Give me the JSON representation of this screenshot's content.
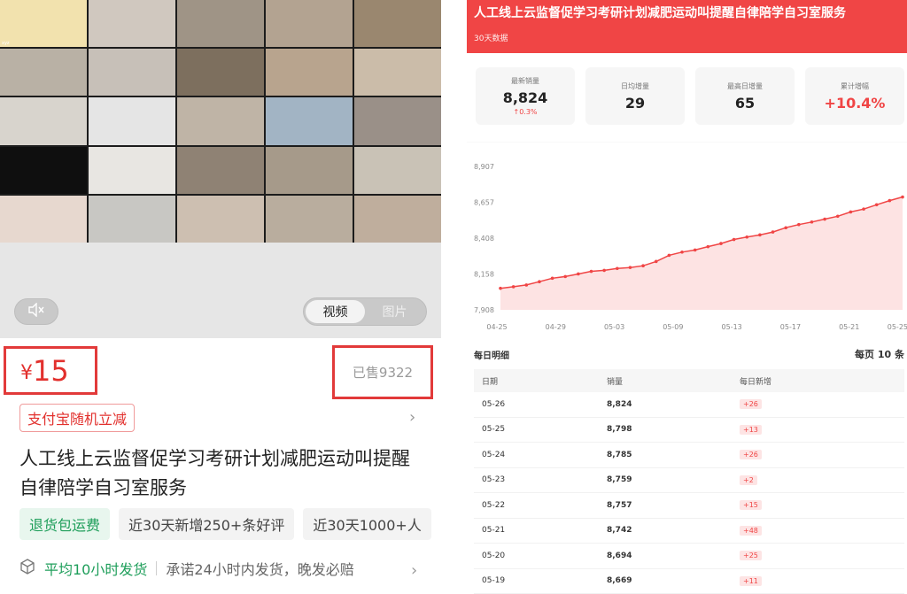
{
  "left": {
    "toggle": {
      "video": "视频",
      "image": "图片"
    },
    "price": {
      "currency": "¥",
      "amount": "15"
    },
    "sold": "已售9322",
    "coupon": "支付宝随机立减",
    "title_line1": "人工线上云监督促学习考研计划减肥运动叫提醒",
    "title_line2": "自律陪学自习室服务",
    "tags": [
      "退货包运费",
      "近30天新增250+条好评",
      "近30天1000+人"
    ],
    "shipping": {
      "highlight": "平均10小时发货",
      "detail": "承诺24小时内发货，晚发必赔"
    },
    "video_tiles": [
      {
        "c": "#f2e2ae",
        "t": "xyz"
      },
      {
        "c": "#d0c8bf",
        "t": ""
      },
      {
        "c": "#9f9486",
        "t": ""
      },
      {
        "c": "#b3a391",
        "t": ""
      },
      {
        "c": "#9a876f",
        "t": ""
      },
      {
        "c": "#b9b1a5",
        "t": ""
      },
      {
        "c": "#c7c0b8",
        "t": ""
      },
      {
        "c": "#7d6f5e",
        "t": ""
      },
      {
        "c": "#b8a48e",
        "t": ""
      },
      {
        "c": "#cbbca9",
        "t": ""
      },
      {
        "c": "#d8d4cd",
        "t": ""
      },
      {
        "c": "#e5e5e5",
        "t": ""
      },
      {
        "c": "#bfb4a6",
        "t": ""
      },
      {
        "c": "#a2b4c4",
        "t": ""
      },
      {
        "c": "#9a9088",
        "t": ""
      },
      {
        "c": "#0f0f0f",
        "t": ""
      },
      {
        "c": "#e8e6e2",
        "t": ""
      },
      {
        "c": "#8f8274",
        "t": ""
      },
      {
        "c": "#a69a8a",
        "t": ""
      },
      {
        "c": "#c9c2b6",
        "t": ""
      },
      {
        "c": "#e7d8cf",
        "t": ""
      },
      {
        "c": "#c8c7c3",
        "t": ""
      },
      {
        "c": "#cdbfb1",
        "t": ""
      },
      {
        "c": "#b9ad9e",
        "t": ""
      },
      {
        "c": "#bfae9d",
        "t": ""
      }
    ]
  },
  "right": {
    "banner": {
      "title": "人工线上云监督促学习考研计划减肥运动叫提醒自律陪学自习室服务",
      "subtitle": "30天数据"
    },
    "kpis": [
      {
        "label": "最新销量",
        "value": "8,824",
        "change": "↑0.3%"
      },
      {
        "label": "日均增量",
        "value": "29"
      },
      {
        "label": "最高日增量",
        "value": "65"
      },
      {
        "label": "累计增幅",
        "value": "+10.4%"
      }
    ],
    "daily": {
      "heading": "每日明细",
      "per_page": "每页 10 条"
    },
    "table": {
      "headers": [
        "日期",
        "销量",
        "每日新增"
      ],
      "rows": [
        [
          "05-26",
          "8,824",
          "+26"
        ],
        [
          "05-25",
          "8,798",
          "+13"
        ],
        [
          "05-24",
          "8,785",
          "+26"
        ],
        [
          "05-23",
          "8,759",
          "+2"
        ],
        [
          "05-22",
          "8,757",
          "+15"
        ],
        [
          "05-21",
          "8,742",
          "+48"
        ],
        [
          "05-20",
          "8,694",
          "+25"
        ],
        [
          "05-19",
          "8,669",
          "+11"
        ]
      ]
    }
  },
  "colors": {
    "accent": "#f04545",
    "highlight_box": "#e23a3a",
    "green": "#1e9e5a"
  },
  "chart_data": {
    "type": "area",
    "title": "",
    "xlabel": "",
    "ylabel": "",
    "x_tick_labels": [
      "04-25",
      "04-29",
      "05-03",
      "05-09",
      "05-13",
      "05-17",
      "05-21",
      "05-25"
    ],
    "y_tick_labels": [
      "8,907",
      "8,657",
      "8,408",
      "8,158",
      "7,908"
    ],
    "ylim": [
      7908,
      8907
    ],
    "x": [
      "04-25",
      "04-26",
      "04-27",
      "04-28",
      "04-29",
      "04-30",
      "05-01",
      "05-02",
      "05-03",
      "05-04",
      "05-05",
      "05-06",
      "05-07",
      "05-08",
      "05-09",
      "05-10",
      "05-11",
      "05-12",
      "05-13",
      "05-14",
      "05-15",
      "05-16",
      "05-17",
      "05-18",
      "05-19",
      "05-20",
      "05-21",
      "05-22",
      "05-23",
      "05-24",
      "05-25",
      "05-26"
    ],
    "values": [
      8058,
      8069,
      8081,
      8104,
      8128,
      8140,
      8158,
      8176,
      8183,
      8196,
      8203,
      8215,
      8245,
      8288,
      8310,
      8325,
      8348,
      8370,
      8398,
      8415,
      8430,
      8450,
      8480,
      8502,
      8520,
      8540,
      8560,
      8590,
      8610,
      8640,
      8669,
      8694
    ],
    "grid": false,
    "legend": "none"
  }
}
